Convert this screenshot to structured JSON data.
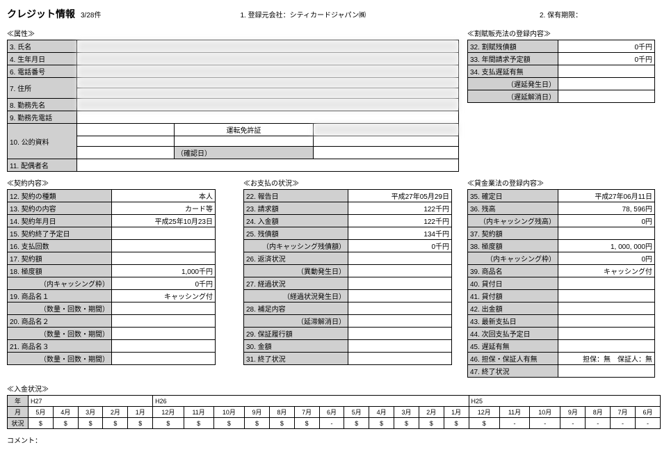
{
  "header": {
    "title": "クレジット情報",
    "count": "3/28件",
    "reg_company_label": "1. 登録元会社：シティカードジャパン㈱",
    "retention_label": "2. 保有期限："
  },
  "attributes": {
    "section": "≪属性≫",
    "rows": [
      {
        "label": "3. 氏名",
        "value": ""
      },
      {
        "label": "4. 生年月日",
        "value": ""
      },
      {
        "label": "6. 電話番号",
        "value": ""
      },
      {
        "label": "7. 住所",
        "value": ""
      },
      {
        "label": "8. 勤務先名",
        "value": ""
      },
      {
        "label": "9. 勤務先電話",
        "value": ""
      }
    ],
    "public_doc_label": "10. 公的資料",
    "public_doc_value": "運転免許証",
    "confirm_label": "（確認日）",
    "spouse_label": "11. 配偶者名"
  },
  "installment": {
    "section": "≪割賦販売法の登録内容≫",
    "rows": [
      {
        "label": "32. 割賦残債額",
        "value": "0千円"
      },
      {
        "label": "33. 年間請求予定額",
        "value": "0千円"
      },
      {
        "label": "34. 支払遅延有無",
        "value": ""
      },
      {
        "label": "（遅延発生日）",
        "value": ""
      },
      {
        "label": "（遅延解消日）",
        "value": ""
      }
    ]
  },
  "contract": {
    "section": "≪契約内容≫",
    "rows": [
      {
        "label": "12. 契約の種類",
        "value": "本人"
      },
      {
        "label": "13. 契約の内容",
        "value": "カード等"
      },
      {
        "label": "14. 契約年月日",
        "value": "平成25年10月23日"
      },
      {
        "label": "15. 契約終了予定日",
        "value": ""
      },
      {
        "label": "16. 支払回数",
        "value": ""
      },
      {
        "label": "17. 契約額",
        "value": ""
      },
      {
        "label": "18. 極度額",
        "value": "1,000千円"
      },
      {
        "label": "（内キャッシング枠）",
        "value": "0千円"
      },
      {
        "label": "19. 商品名１",
        "value": "キャッシング付"
      },
      {
        "label": "（数量・回数・期間）",
        "value": ""
      },
      {
        "label": "20. 商品名２",
        "value": ""
      },
      {
        "label": "（数量・回数・期間）",
        "value": ""
      },
      {
        "label": "21. 商品名３",
        "value": ""
      },
      {
        "label": "（数量・回数・期間）",
        "value": ""
      }
    ]
  },
  "payment_status": {
    "section": "≪お支払の状況≫",
    "rows": [
      {
        "label": "22. 報告日",
        "value": "平成27年05月29日"
      },
      {
        "label": "23. 請求額",
        "value": "122千円"
      },
      {
        "label": "24. 入金額",
        "value": "122千円"
      },
      {
        "label": "25. 残債額",
        "value": "134千円"
      },
      {
        "label": "（内キャッシング残債額）",
        "value": "0千円"
      },
      {
        "label": "26. 返済状況",
        "value": ""
      },
      {
        "label": "（異動発生日）",
        "value": ""
      },
      {
        "label": "27. 経過状況",
        "value": ""
      },
      {
        "label": "（経過状況発生日）",
        "value": ""
      },
      {
        "label": "28. 補足内容",
        "value": ""
      },
      {
        "label": "（延滞解消日）",
        "value": ""
      },
      {
        "label": "29. 保証履行額",
        "value": ""
      },
      {
        "label": "30. 金額",
        "value": ""
      },
      {
        "label": "31. 終了状況",
        "value": ""
      }
    ]
  },
  "moneylending": {
    "section": "≪貸金業法の登録内容≫",
    "rows": [
      {
        "label": "35. 確定日",
        "value": "平成27年06月11日"
      },
      {
        "label": "36. 残高",
        "value": "78, 596円"
      },
      {
        "label": "（内キャッシング残高）",
        "value": "0円"
      },
      {
        "label": "37. 契約額",
        "value": ""
      },
      {
        "label": "38. 極度額",
        "value": "1, 000, 000円"
      },
      {
        "label": "（内キャッシング枠）",
        "value": "0円"
      },
      {
        "label": "39. 商品名",
        "value": "キャッシング付"
      },
      {
        "label": "40. 貸付日",
        "value": ""
      },
      {
        "label": "41. 貸付額",
        "value": ""
      },
      {
        "label": "42. 出金額",
        "value": ""
      },
      {
        "label": "43. 最新支払日",
        "value": ""
      },
      {
        "label": "44. 次回支払予定日",
        "value": ""
      },
      {
        "label": "45. 遅延有無",
        "value": ""
      },
      {
        "label": "46. 担保・保証人有無",
        "value": "担保：無　保証人：無"
      },
      {
        "label": "47. 終了状況",
        "value": ""
      }
    ]
  },
  "payment_history": {
    "section": "≪入金状況≫",
    "year_label": "年",
    "month_label": "月",
    "status_label": "状況",
    "years": [
      "H27",
      "",
      "",
      "",
      "",
      "H26",
      "",
      "",
      "",
      "",
      "",
      "",
      "",
      "",
      "",
      "",
      "",
      "H25",
      "",
      "",
      "",
      "",
      "",
      ""
    ],
    "months": [
      "5月",
      "4月",
      "3月",
      "2月",
      "1月",
      "12月",
      "11月",
      "10月",
      "9月",
      "8月",
      "7月",
      "6月",
      "5月",
      "4月",
      "3月",
      "2月",
      "1月",
      "12月",
      "11月",
      "10月",
      "9月",
      "8月",
      "7月",
      "6月"
    ],
    "status": [
      "$",
      "$",
      "$",
      "$",
      "$",
      "$",
      "$",
      "$",
      "$",
      "$",
      "$",
      "-",
      "$",
      "$",
      "$",
      "$",
      "$",
      "$",
      "-",
      "-",
      "-",
      "-",
      "-",
      "-"
    ]
  },
  "comment_label": "コメント："
}
